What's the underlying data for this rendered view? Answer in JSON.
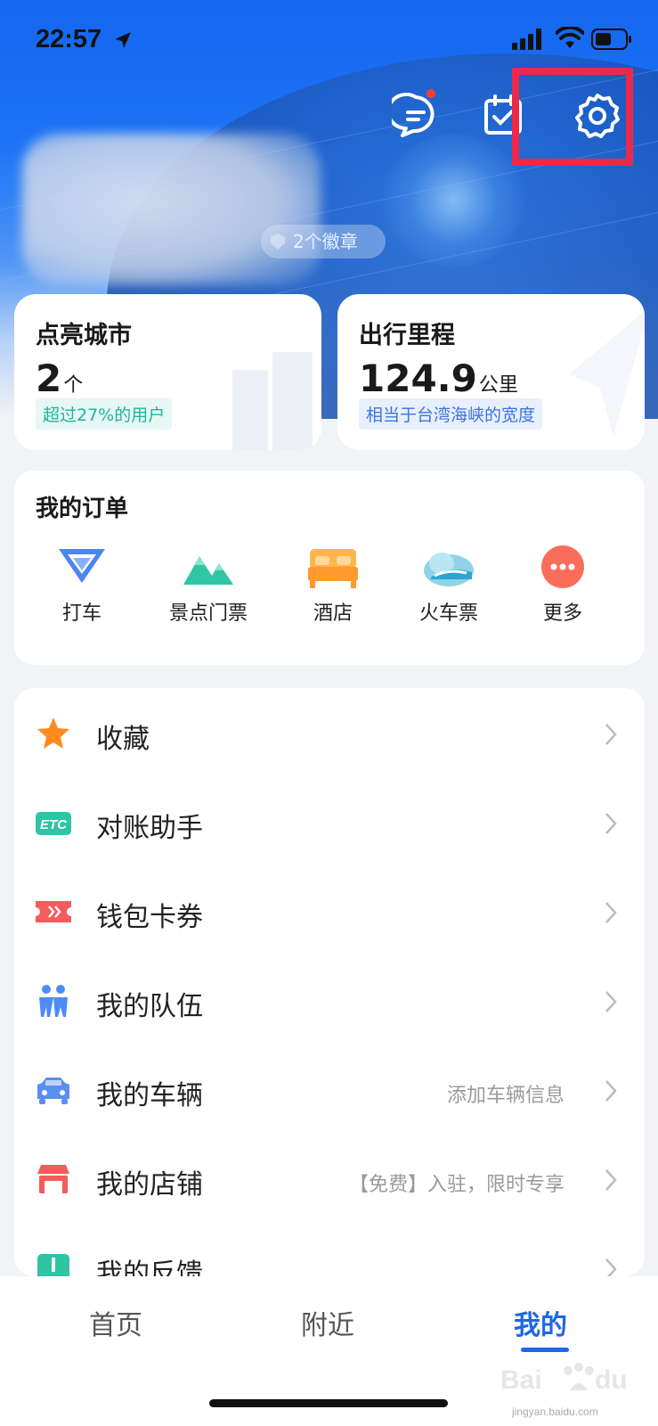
{
  "status_bar": {
    "time": "22:57"
  },
  "header": {
    "icons": [
      "message-icon",
      "calendar-check-icon",
      "settings-gear-icon"
    ],
    "badge_text": "2个徽章"
  },
  "stats": [
    {
      "title": "点亮城市",
      "value": "2",
      "unit": "个",
      "note": "超过27%的用户"
    },
    {
      "title": "出行里程",
      "value": "124.9",
      "unit": "公里",
      "note": "相当于台湾海峡的宽度"
    }
  ],
  "orders": {
    "title": "我的订单",
    "items": [
      {
        "label": "打车",
        "icon": "taxi-icon"
      },
      {
        "label": "景点门票",
        "icon": "mountain-ticket-icon"
      },
      {
        "label": "酒店",
        "icon": "hotel-bed-icon"
      },
      {
        "label": "火车票",
        "icon": "train-icon"
      },
      {
        "label": "更多",
        "icon": "more-icon"
      }
    ]
  },
  "menu": [
    {
      "label": "收藏",
      "hint": "",
      "icon": "star-icon"
    },
    {
      "label": "对账助手",
      "hint": "",
      "icon": "etc-icon"
    },
    {
      "label": "钱包卡券",
      "hint": "",
      "icon": "ticket-icon"
    },
    {
      "label": "我的队伍",
      "hint": "",
      "icon": "team-icon"
    },
    {
      "label": "我的车辆",
      "hint": "添加车辆信息",
      "icon": "car-icon"
    },
    {
      "label": "我的店铺",
      "hint": "【免费】入驻，限时专享",
      "icon": "store-icon"
    },
    {
      "label": "我的反馈",
      "hint": "",
      "icon": "feedback-icon"
    }
  ],
  "tabs": [
    {
      "label": "首页",
      "active": false
    },
    {
      "label": "附近",
      "active": false
    },
    {
      "label": "我的",
      "active": true
    }
  ],
  "watermark": {
    "text": "jingyan.baidu.com"
  },
  "colors": {
    "primary": "#1f66e8",
    "highlight": "#ee2848",
    "green_tag": "#1fb59b",
    "blue_tag": "#3b73e0"
  }
}
